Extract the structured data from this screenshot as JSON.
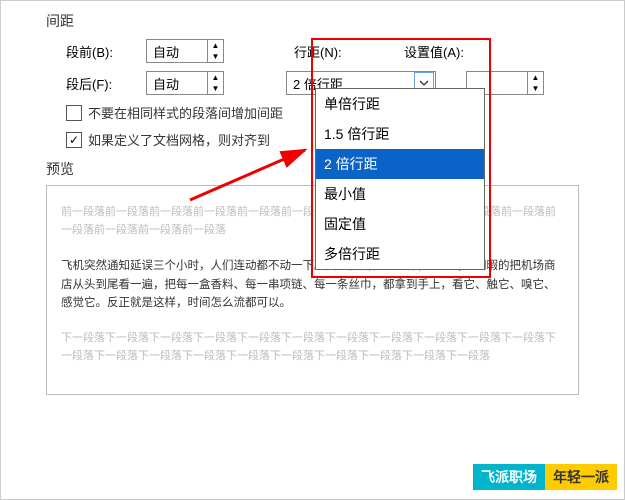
{
  "section_spacing": "间距",
  "before_label": "段前(B):",
  "after_label": "段后(F):",
  "auto_value": "自动",
  "linespace_label": "行距(N):",
  "setvalue_label": "设置值(A):",
  "selected_linespace": "2 倍行距",
  "dropdown_options": [
    "单倍行距",
    "1.5 倍行距",
    "2 倍行距",
    "最小值",
    "固定值",
    "多倍行距"
  ],
  "chk1_label": "不要在相同样式的段落间增加间距",
  "chk2_label": "如果定义了文档网格，则对齐到网",
  "chk1_label_trunc": "不要在相同样式的段落间增加间距",
  "chk2_label_trunc": "如果定义了文档网格，则对齐到",
  "preview_title": "预览",
  "gray_before": "前一段落前一段落前一段落前一段落前一段落前一段落前一段落前一段落前一段落前一段落前一段落前一段落前一段落前一段落前一段落",
  "body_text": "飞机突然通知延误三个小时，人们连动都不动一下。因为预期就是这样，于是可以闲暇的把机场商店从头到尾看一遍，把每一盒香料、每一串项链、每一条丝巾，都拿到手上，看它、触它、嗅它、感觉它。反正就是这样，时间怎么流都可以。",
  "gray_after": "下一段落下一段落下一段落下一段落下一段落下一段落下一段落下一段落下一段落下一段落下一段落下一段落下一段落下一段落下一段落下一段落下一段落下一段落下一段落下一段落下一段落",
  "watermark_1": "飞派职场",
  "watermark_2": "年轻一派",
  "chart_data": null
}
